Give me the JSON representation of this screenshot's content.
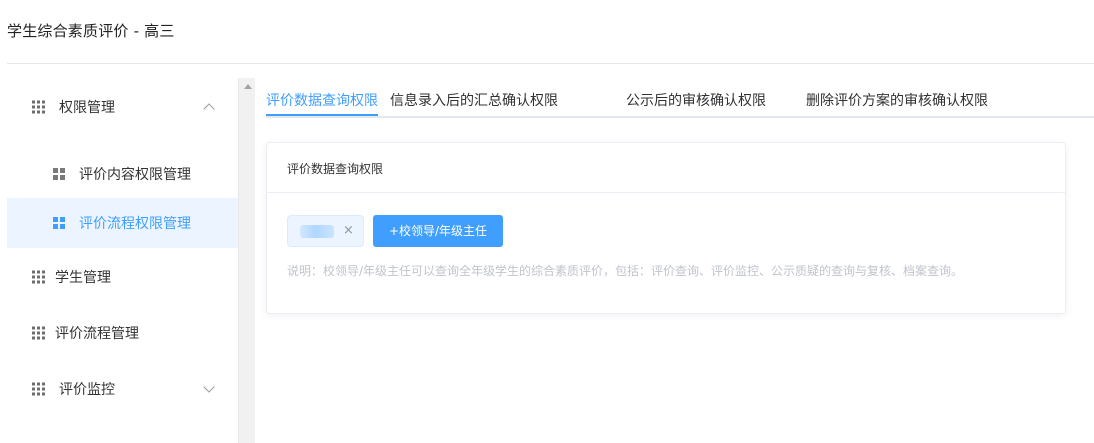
{
  "header": {
    "title": "学生综合素质评价 - 高三"
  },
  "sidebar": {
    "items": [
      {
        "label": "权限管理",
        "icon": "grid-icon",
        "expanded": true,
        "children": [
          {
            "label": "评价内容权限管理",
            "icon": "apps-icon",
            "active": false
          },
          {
            "label": "评价流程权限管理",
            "icon": "apps-icon",
            "active": true
          }
        ]
      },
      {
        "label": "学生管理",
        "icon": "grid-icon"
      },
      {
        "label": "评价流程管理",
        "icon": "grid-icon"
      },
      {
        "label": "评价监控",
        "icon": "grid-icon",
        "expanded": false
      }
    ]
  },
  "tabs": [
    {
      "label": "评价数据查询权限",
      "active": true
    },
    {
      "label": "信息录入后的汇总确认权限",
      "active": false
    },
    {
      "label": "公示后的审核确认权限",
      "active": false
    },
    {
      "label": "删除评价方案的审核确认权限",
      "active": false
    }
  ],
  "card": {
    "title": "评价数据查询权限",
    "tag_close": "×",
    "add_button": "+校领导/年级主任",
    "note": "说明：校领导/年级主任可以查询全年级学生的综合素质评价，包括：评价查询、评价监控、公示质疑的查询与复核、档案查询。"
  },
  "colors": {
    "accent": "#409eff",
    "active_bg": "#ecf5ff",
    "note_text": "#c0c4cc"
  }
}
